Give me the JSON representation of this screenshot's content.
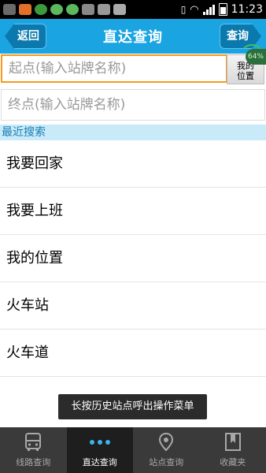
{
  "status_bar": {
    "time": "11:23"
  },
  "header": {
    "title": "直达查询",
    "back_label": "返回",
    "query_label": "查询"
  },
  "start": {
    "placeholder": "起点(输入站牌名称)",
    "myloc_label_1": "我的",
    "myloc_label_2": "位置"
  },
  "badge": {
    "text": "64%"
  },
  "end": {
    "placeholder": "终点(输入站牌名称)"
  },
  "recent": {
    "header": "最近搜索",
    "items": [
      "我要回家",
      "我要上班",
      "我的位置",
      "火车站",
      "火车道"
    ]
  },
  "toast": "长按历史站点呼出操作菜单",
  "bottom_nav": {
    "items": [
      {
        "label": "线路查询",
        "icon": "bus-icon"
      },
      {
        "label": "直达查询",
        "icon": "dots-icon",
        "active": true
      },
      {
        "label": "站点查询",
        "icon": "location-pin-icon"
      },
      {
        "label": "收藏夹",
        "icon": "bookmark-icon"
      }
    ]
  },
  "colors": {
    "accent": "#1ba4e2",
    "input_focus": "#f39a1e",
    "recent_header_bg": "#c9eaf9",
    "nav_bg": "#3a3a3a"
  }
}
